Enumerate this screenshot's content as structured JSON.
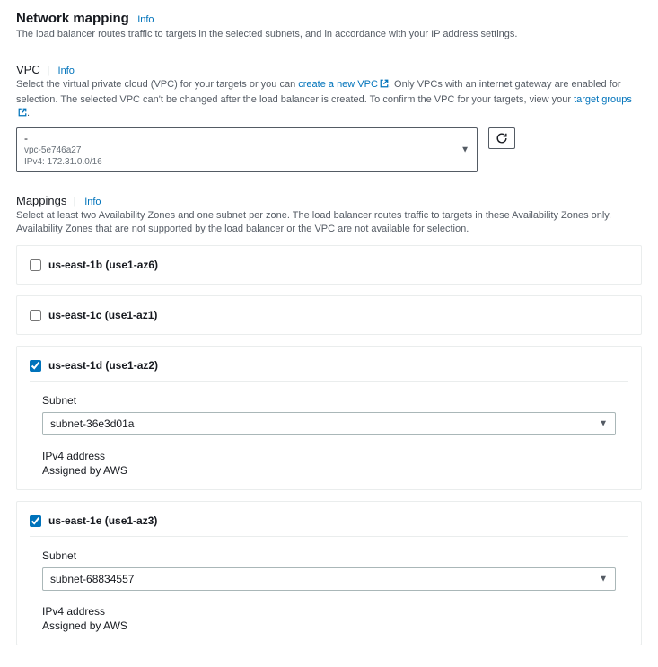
{
  "header": {
    "title": "Network mapping",
    "info": "Info",
    "subtext": "The load balancer routes traffic to targets in the selected subnets, and in accordance with your IP address settings."
  },
  "vpc": {
    "label": "VPC",
    "info": "Info",
    "help_pre": "Select the virtual private cloud (VPC) for your targets or you can ",
    "create_link": "create a new VPC",
    "help_mid": ". Only VPCs with an internet gateway are enabled for selection. The selected VPC can't be changed after the load balancer is created. To confirm the VPC for your targets, view your ",
    "target_groups_link": "target groups",
    "help_post": ".",
    "selected": {
      "dash": "-",
      "id": "vpc-5e746a27",
      "cidr": "IPv4: 172.31.0.0/16"
    }
  },
  "mappings": {
    "label": "Mappings",
    "info": "Info",
    "help": "Select at least two Availability Zones and one subnet per zone. The load balancer routes traffic to targets in these Availability Zones only. Availability Zones that are not supported by the load balancer or the VPC are not available for selection.",
    "subnet_label": "Subnet",
    "ipv4_label": "IPv4 address",
    "ipv4_value": "Assigned by AWS",
    "zones": [
      {
        "name": "us-east-1b (use1-az6)",
        "checked": false
      },
      {
        "name": "us-east-1c (use1-az1)",
        "checked": false
      },
      {
        "name": "us-east-1d (use1-az2)",
        "checked": true,
        "subnet": "subnet-36e3d01a"
      },
      {
        "name": "us-east-1e (use1-az3)",
        "checked": true,
        "subnet": "subnet-68834557"
      }
    ]
  }
}
